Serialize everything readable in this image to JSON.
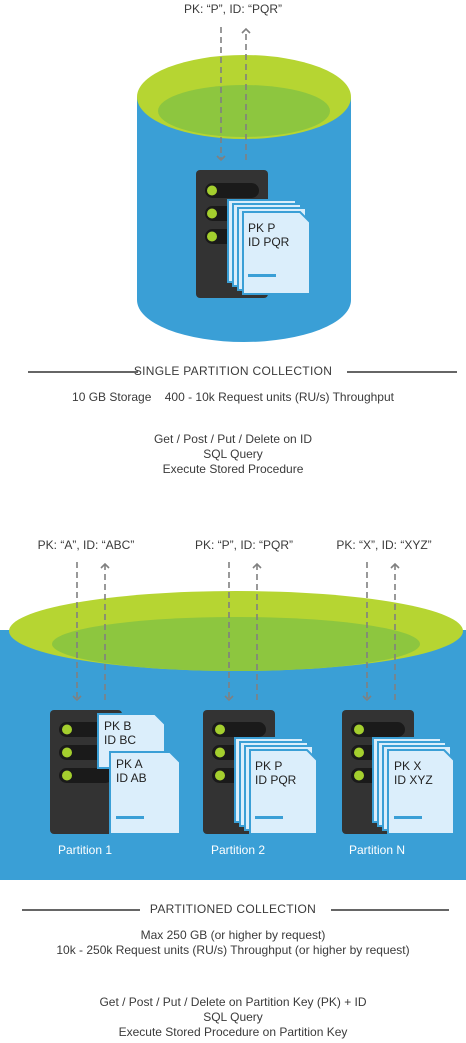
{
  "single": {
    "request_label": "PK: “P”, ID: “PQR”",
    "doc_pk": "PK P",
    "doc_id": "ID PQR",
    "title": "SINGLE PARTITION COLLECTION",
    "storage": "10 GB Storage",
    "throughput": "400 - 10k Request units (RU/s) Throughput",
    "ops": [
      "Get / Post / Put / Delete on ID",
      "SQL Query",
      "Execute Stored Procedure"
    ]
  },
  "partitioned": {
    "request_labels": [
      "PK: “A”, ID: “ABC”",
      "PK: “P”, ID: “PQR”",
      "PK: “X”, ID: “XYZ”"
    ],
    "partitions": [
      {
        "label": "Partition 1",
        "docs": [
          {
            "pk": "PK B",
            "id": "ID BC"
          },
          {
            "pk": "PK A",
            "id": "ID AB"
          }
        ]
      },
      {
        "label": "Partition 2",
        "docs": [
          {
            "pk": "PK P",
            "id": "ID PQR"
          }
        ]
      },
      {
        "label": "Partition N",
        "docs": [
          {
            "pk": "PK X",
            "id": "ID XYZ"
          }
        ]
      }
    ],
    "title": "PARTITIONED COLLECTION",
    "limits": [
      "Max 250 GB  (or higher by request)",
      "10k - 250k Request units (RU/s) Throughput (or higher by request)"
    ],
    "ops": [
      "Get / Post / Put / Delete on Partition Key (PK) + ID",
      "SQL Query",
      "Execute Stored Procedure on Partition Key"
    ]
  },
  "colors": {
    "blue": "#3a9fd6",
    "green_light": "#b6d532",
    "green_dark": "#8dc63f",
    "server": "#333333",
    "led": "#a4cf2e",
    "doc": "#dbeefb",
    "accent": "#3a9fd6",
    "arrow": "#808080"
  }
}
